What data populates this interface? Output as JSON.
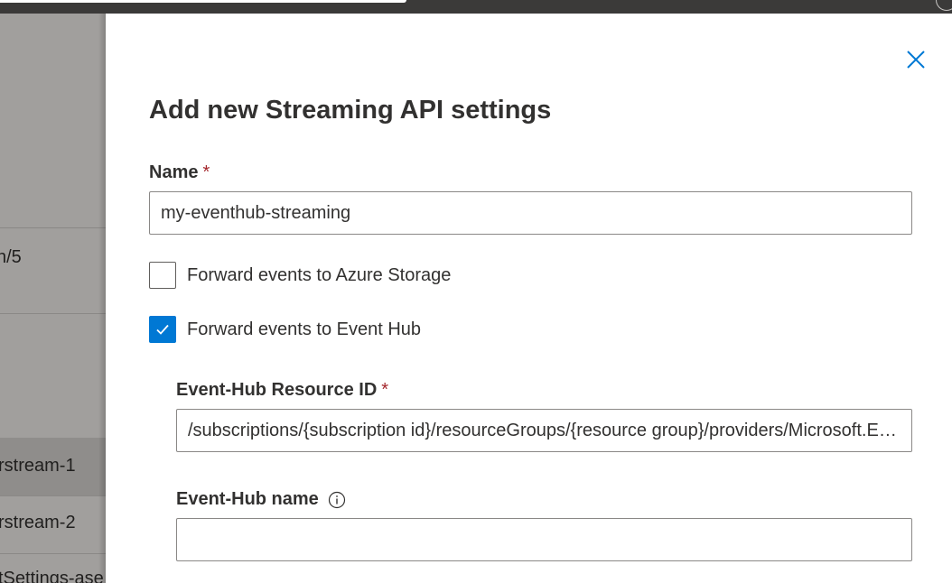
{
  "background": {
    "partial_texts": [
      "n/5",
      "rstream-1",
      "rstream-2",
      "tSettings-ase"
    ]
  },
  "panel": {
    "title": "Add new Streaming API settings",
    "close_icon": "close-icon",
    "name_field": {
      "label": "Name",
      "required_mark": "*",
      "value": "my-eventhub-streaming"
    },
    "storage_checkbox": {
      "label": "Forward events to Azure Storage",
      "checked": false
    },
    "eventhub_checkbox": {
      "label": "Forward events to Event Hub",
      "checked": true
    },
    "eventhub_resource_id": {
      "label": "Event-Hub Resource ID",
      "required_mark": "*",
      "value": "/subscriptions/{subscription id}/resourceGroups/{resource group}/providers/Microsoft.EventHub/namespaces/{namespace}"
    },
    "eventhub_name": {
      "label": "Event-Hub name",
      "info_icon": "info-icon",
      "value": ""
    }
  },
  "colors": {
    "accent": "#0078d4",
    "required": "#a4262c",
    "text": "#323130",
    "overlay": "#a19f9d",
    "topbar": "#3b3a39"
  }
}
